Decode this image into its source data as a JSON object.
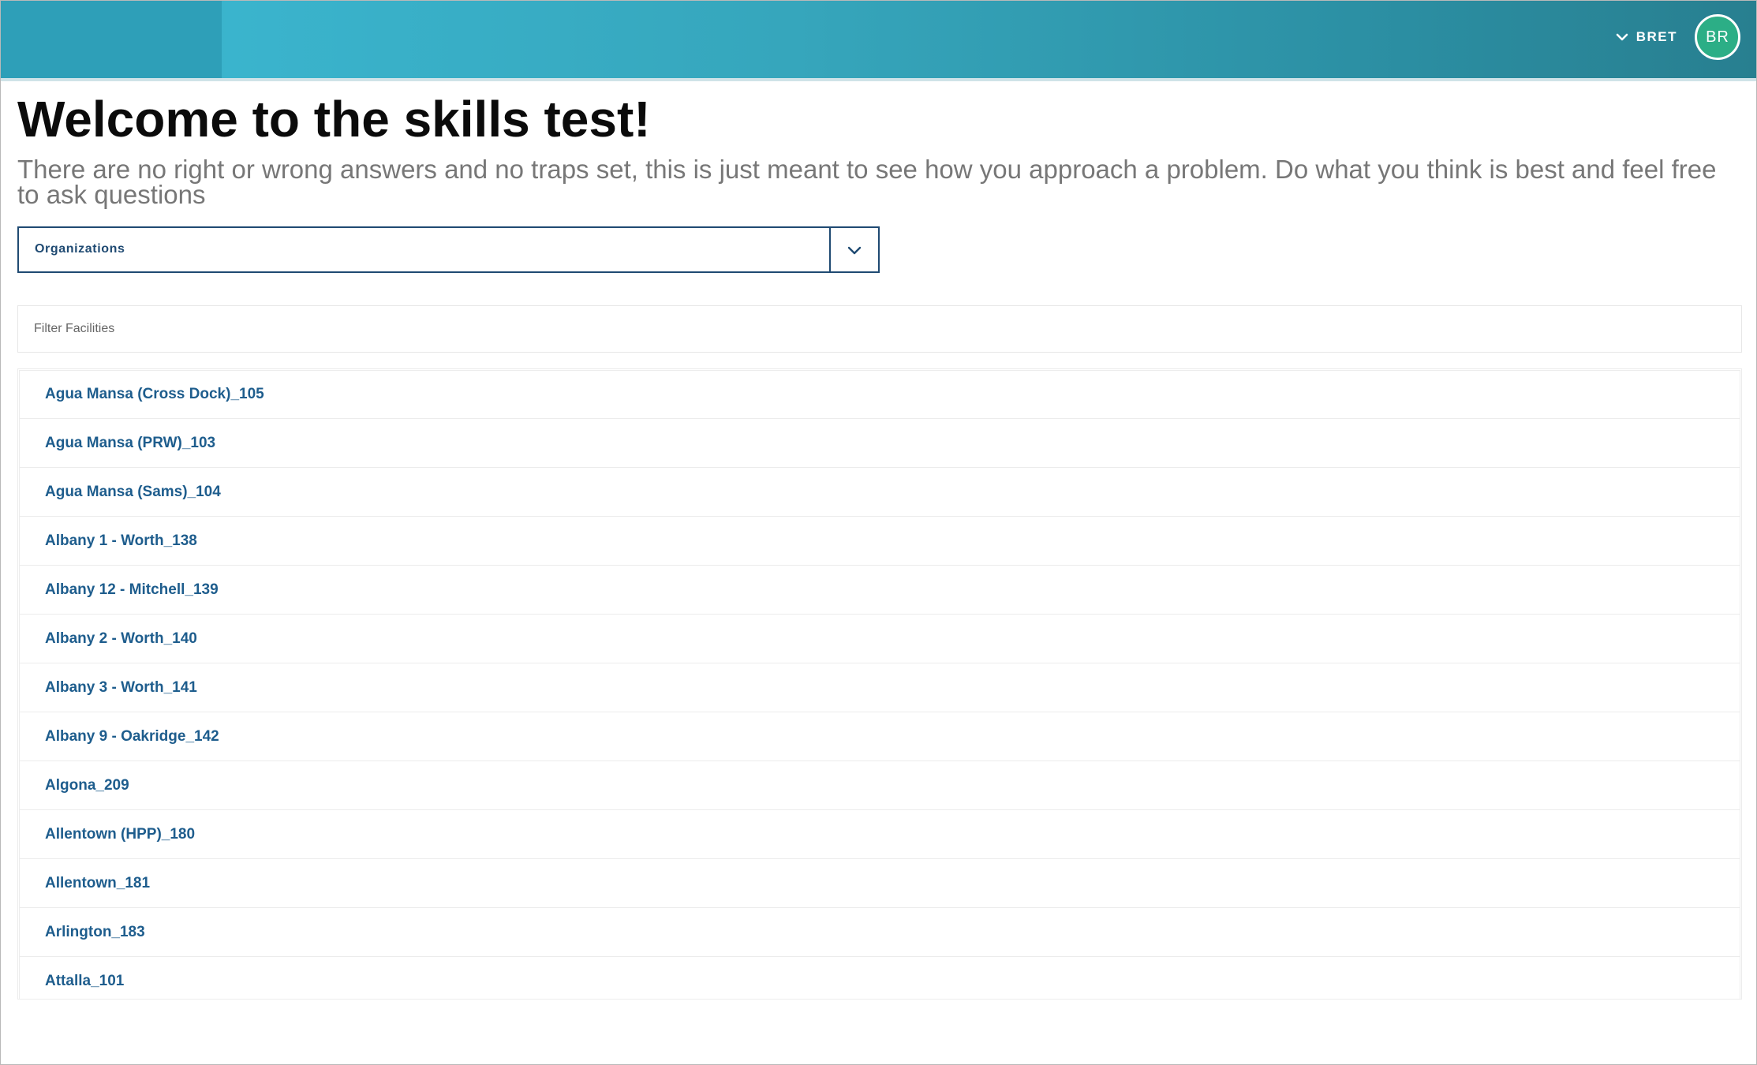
{
  "header": {
    "user_name": "BRET",
    "avatar_initials": "BR",
    "chevron_icon": "chevron-down-icon"
  },
  "main": {
    "title": "Welcome to the skills test!",
    "intro": "There are no right or wrong answers and no traps set, this is just meant to see how you approach a problem. Do what you think is best and feel free to ask questions",
    "org_select": {
      "selected": "Organizations",
      "caret_icon": "chevron-down-icon"
    },
    "filter": {
      "placeholder": "Filter Facilities",
      "value": ""
    },
    "facilities": [
      "Agua Mansa (Cross Dock)_105",
      "Agua Mansa (PRW)_103",
      "Agua Mansa (Sams)_104",
      "Albany 1 - Worth_138",
      "Albany 12 - Mitchell_139",
      "Albany 2 - Worth_140",
      "Albany 3 - Worth_141",
      "Albany 9 - Oakridge_142",
      "Algona_209",
      "Allentown (HPP)_180",
      "Allentown_181",
      "Arlington_183",
      "Attalla_101"
    ]
  },
  "colors": {
    "header_start": "#3ab4cd",
    "header_end": "#287f90",
    "avatar_bg": "#2cae86",
    "link_text": "#1e5d8d",
    "select_border": "#1f4a72"
  }
}
